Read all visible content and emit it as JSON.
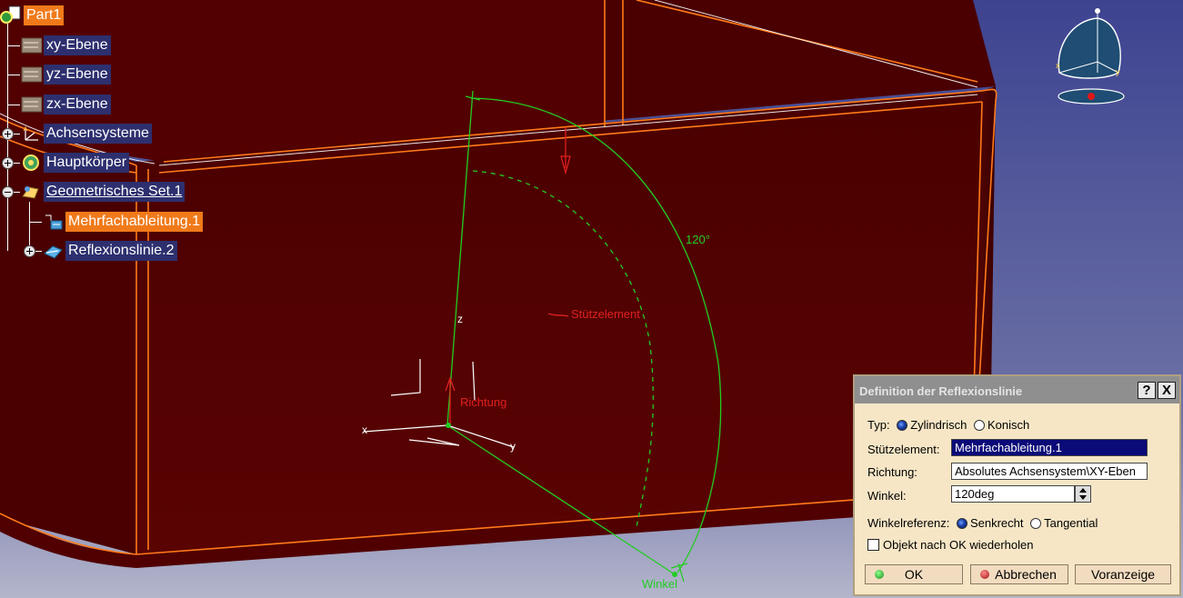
{
  "tree": {
    "root": "Part1",
    "items": [
      {
        "label": "xy-Ebene"
      },
      {
        "label": "yz-Ebene"
      },
      {
        "label": "zx-Ebene"
      },
      {
        "label": "Achsensysteme"
      },
      {
        "label": "Hauptkörper"
      },
      {
        "label": "Geometrisches Set.1"
      },
      {
        "label": "Mehrfachableitung.1"
      },
      {
        "label": "Reflexionslinie.2"
      }
    ]
  },
  "sketch": {
    "angle_label": "120°",
    "support_label": "Stützelement",
    "direction_label": "Richtung",
    "angle_handle_label": "Winkel",
    "axis_x": "x",
    "axis_y": "y",
    "axis_z": "z"
  },
  "dialog": {
    "title": "Definition der Reflexionslinie",
    "help_btn": "?",
    "close_btn": "X",
    "type_label": "Typ:",
    "type_options": [
      "Zylindrisch",
      "Konisch"
    ],
    "type_selected": "Zylindrisch",
    "support_label": "Stützelement:",
    "support_value": "Mehrfachableitung.1",
    "direction_label": "Richtung:",
    "direction_value": "Absolutes Achsensystem\\XY-Eben",
    "angle_label": "Winkel:",
    "angle_value": "120deg",
    "angle_ref_label": "Winkelreferenz:",
    "angle_ref_options": [
      "Senkrecht",
      "Tangential"
    ],
    "angle_ref_selected": "Senkrecht",
    "repeat_label": "Objekt nach OK wiederholen",
    "repeat_checked": false,
    "ok_label": "OK",
    "cancel_label": "Abbrechen",
    "preview_label": "Voranzeige"
  },
  "colors": {
    "part_body": "#5c0000",
    "edge": "#ff7a1a",
    "background_top": "#3d4390",
    "sketch_green": "#22cc22",
    "sketch_red": "#e02020",
    "tree_label_bg": "#2d2f6e",
    "selection": "#f07a1a"
  }
}
